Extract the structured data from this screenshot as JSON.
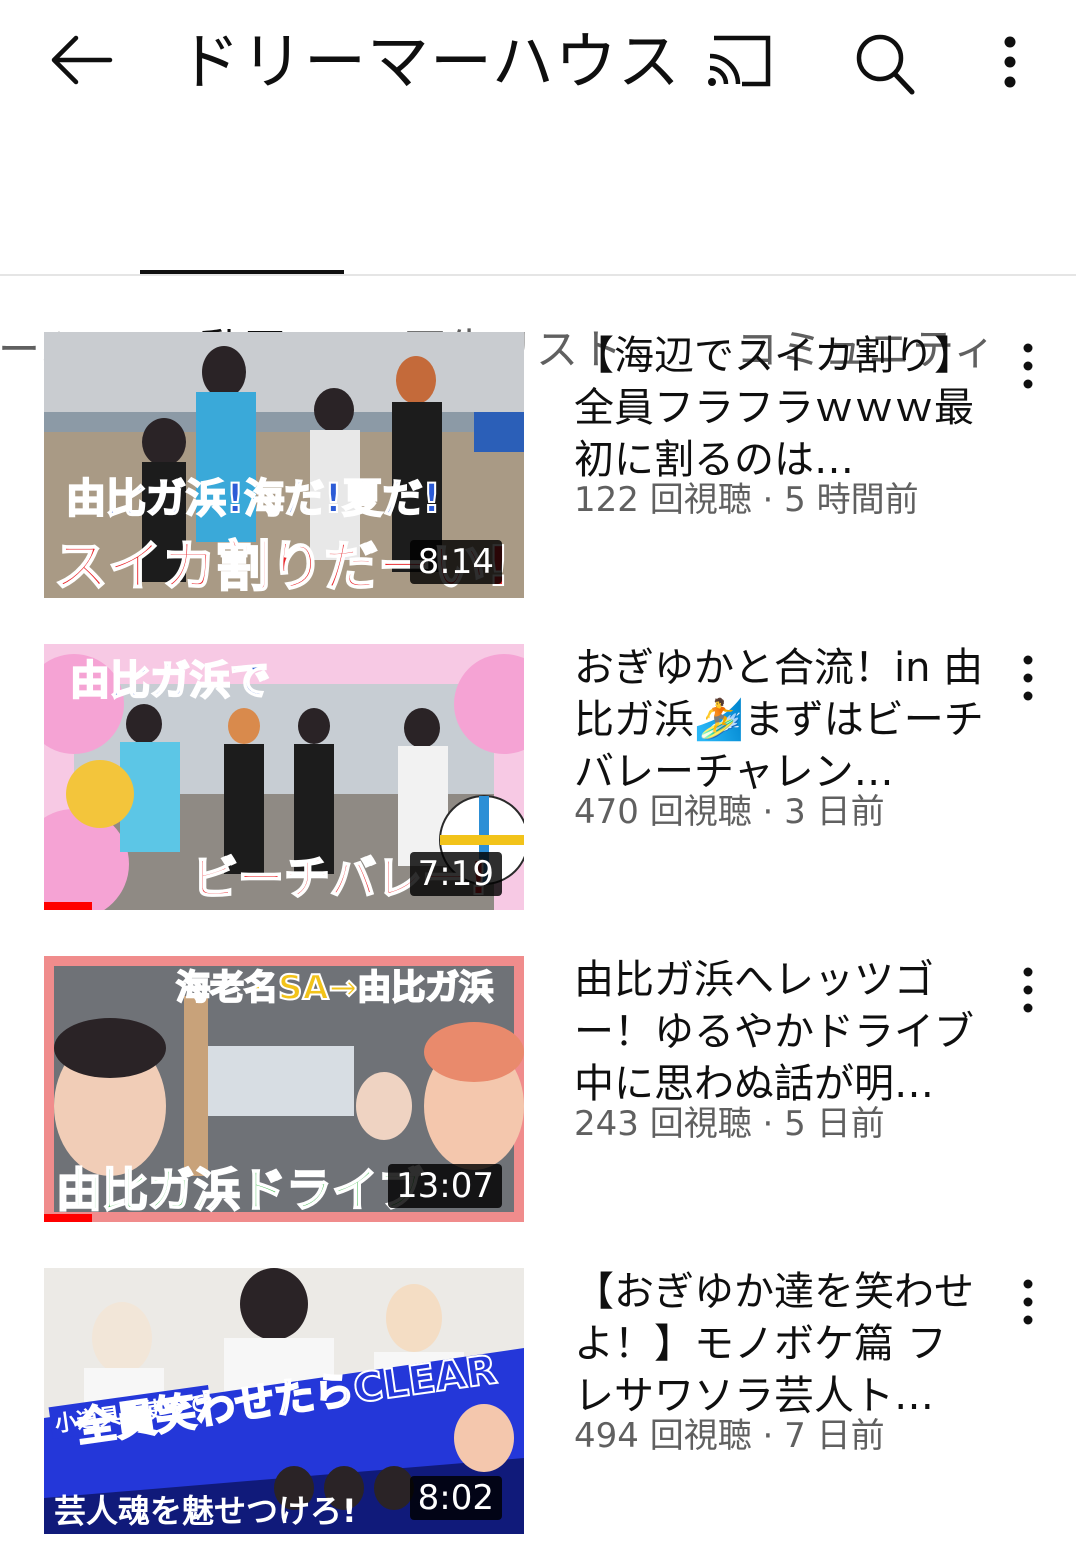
{
  "header": {
    "title": "ドリーマーハウス",
    "icons": [
      "back-arrow-icon",
      "cast-icon",
      "search-icon",
      "more-vert-icon"
    ]
  },
  "tabs": [
    {
      "label": "ーム",
      "active": false
    },
    {
      "label": "動画",
      "active": true
    },
    {
      "label": "再生リスト",
      "active": false
    },
    {
      "label": "コミュニティ",
      "active": false
    }
  ],
  "videos": [
    {
      "title": "【海辺でスイカ割り】全員フラフラｗｗｗ最初に割るのは…",
      "views": "122 回視聴",
      "age": "5 時間前",
      "meta": "122 回視聴 · 5 時間前",
      "duration": "8:14",
      "thumb_text": [
        "由比ガ浜!海だ!夏だ!",
        "スイカ割りだーい!"
      ],
      "watched": false
    },
    {
      "title": "おぎゆかと合流！in 由比ガ浜🏄まずはビーチバレーチャレン…",
      "views": "470 回視聴",
      "age": "3 日前",
      "meta": "470 回視聴 · 3 日前",
      "duration": "7:19",
      "thumb_text": [
        "由比ガ浜で",
        "ビーチバレー!"
      ],
      "watched": true
    },
    {
      "title": "由比ガ浜へレッツゴー！ゆるやかドライブ中に思わぬ話が明…",
      "views": "243 回視聴",
      "age": "5 日前",
      "meta": "243 回視聴 · 5 日前",
      "duration": "13:07",
      "thumb_text": [
        "海老名SA→由比ガ浜",
        "由比ガ浜ドライブ"
      ],
      "watched": true
    },
    {
      "title": "【おぎゆか達を笑わせよ！】モノボケ篇 フレサワソラ芸人ト…",
      "views": "494 回視聴",
      "age": "7 日前",
      "meta": "494 回視聴 · 7 日前",
      "duration": "8:02",
      "thumb_text": [
        "小道具を使って",
        "全員笑わせたらCLEAR",
        "芸人魂を魅せつけろ!"
      ],
      "watched": false
    }
  ],
  "colors": {
    "progress": "#ff0000",
    "text": "#0f0f0f",
    "secondary": "#606060"
  }
}
